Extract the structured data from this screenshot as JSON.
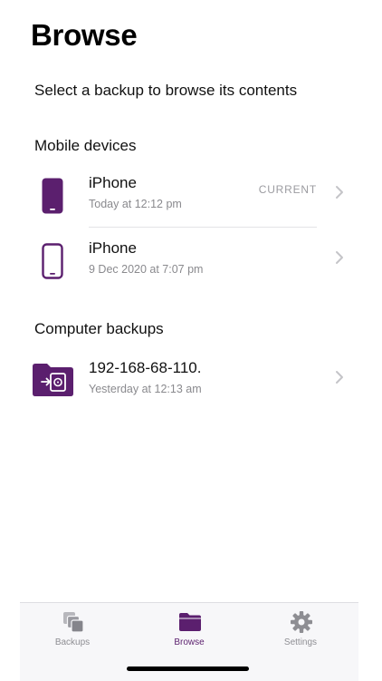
{
  "header": {
    "title": "Browse",
    "subtitle": "Select a backup to browse its contents"
  },
  "sections": {
    "mobile": {
      "label": "Mobile devices",
      "items": [
        {
          "name": "iPhone",
          "date": "Today at 12:12 pm",
          "badge": "CURRENT",
          "icon": "iphone-filled-icon"
        },
        {
          "name": "iPhone",
          "date": "9 Dec 2020 at 7:07 pm",
          "badge": "",
          "icon": "iphone-outline-icon"
        }
      ]
    },
    "computer": {
      "label": "Computer backups",
      "items": [
        {
          "name": "192-168-68-110.",
          "date": "Yesterday at 12:13 am",
          "icon": "computer-backup-folder-icon"
        }
      ]
    }
  },
  "tabbar": {
    "tabs": [
      {
        "label": "Backups",
        "icon": "backups-icon",
        "active": false
      },
      {
        "label": "Browse",
        "icon": "folder-icon",
        "active": true
      },
      {
        "label": "Settings",
        "icon": "gear-icon",
        "active": false
      }
    ]
  },
  "colors": {
    "accent": "#5b1f6e",
    "secondary_text": "#8a8a8e",
    "inactive_tab": "#8e8e93"
  }
}
